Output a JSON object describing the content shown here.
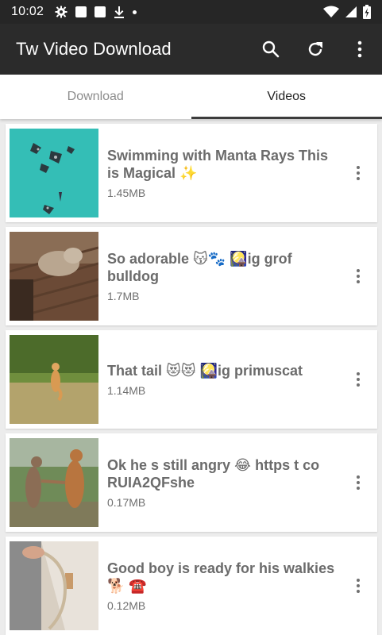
{
  "status_bar": {
    "time": "10:02"
  },
  "app_bar": {
    "title": "Tw Video Download",
    "icons": [
      "search-icon",
      "refresh-icon",
      "more-vert-icon"
    ]
  },
  "tabs": [
    {
      "label": "Download",
      "active": false
    },
    {
      "label": "Videos",
      "active": true
    }
  ],
  "videos": [
    {
      "title": "Swimming with Manta Rays  This is Magical  ✨",
      "size": "1.45MB"
    },
    {
      "title": "So adorable 😽🐾 🎑ig  grof bulldog",
      "size": "1.7MB"
    },
    {
      "title": "That tail 😻😻 🎑ig  primuscat",
      "size": "1.14MB"
    },
    {
      "title": "Ok he s still angry  😂 https t co RUIA2QFshe",
      "size": "0.17MB"
    },
    {
      "title": "Good boy is ready for his walkies 🐕 ☎️",
      "size": "0.12MB"
    }
  ],
  "colors": {
    "app_bar": "#2b2b2b",
    "status_bar": "#262626",
    "background": "#ececec"
  }
}
